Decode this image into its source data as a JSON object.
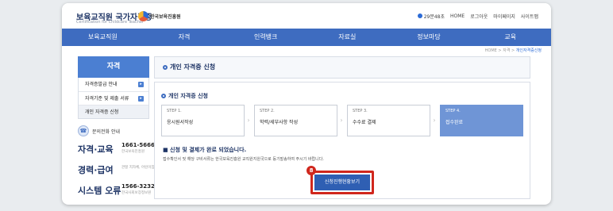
{
  "header": {
    "logo_main": "보육교직원 국가자격증",
    "logo_sub": "Certification for Childcare Teacher",
    "org_name": "한국보육진흥원",
    "top_links": [
      "29분48초",
      "HOME",
      "로그아웃",
      "마이페이지",
      "사이트맵"
    ]
  },
  "main_nav": [
    "보육교직원",
    "자격",
    "인력뱅크",
    "자료실",
    "정보마당",
    "교육"
  ],
  "breadcrumb": [
    "HOME",
    "자격",
    "개인자격증신청"
  ],
  "sidebar": {
    "title": "자격",
    "items": [
      {
        "label": "자격증발급 안내",
        "arrow": "▸"
      },
      {
        "label": "자격기준 및 제출 서류",
        "arrow": "▸"
      },
      {
        "label": "개인 자격증 신청",
        "arrow": ""
      }
    ],
    "phone_title": "문의전화 안내",
    "contacts": [
      {
        "label": "자격·교육",
        "number": "1661-5666",
        "sub": "한국보육진흥원"
      },
      {
        "label": "경력·급여",
        "number": "",
        "sub": "관할 지자체, 어린이집"
      },
      {
        "label": "시스템 오류",
        "number": "1566-3232",
        "sub": "한국사회보장정보원"
      }
    ]
  },
  "content": {
    "title": "개인 자격증 신청",
    "section_title": "개인 자격증 신청",
    "steps": [
      {
        "num": "STEP 1.",
        "name": "응시원서작성"
      },
      {
        "num": "STEP 2.",
        "name": "학력/세부사항 작성"
      },
      {
        "num": "STEP 3.",
        "name": "수수료 결제"
      },
      {
        "num": "STEP 4.",
        "name": "접수완료"
      }
    ],
    "done_title": "■ 신청 및 결제가 완료 되었습니다.",
    "done_desc": "접수확인서 및 해당 구비서류는 한국보육진흥원 교직원지원국으로 등기발송하여 주시기 바랍니다.",
    "view_button": "신청진행현황보기",
    "badge": "8"
  },
  "colors": {
    "nav_blue": "#3e6cc0",
    "highlight_red": "#d0271d",
    "active_step": "#6f95d6"
  }
}
